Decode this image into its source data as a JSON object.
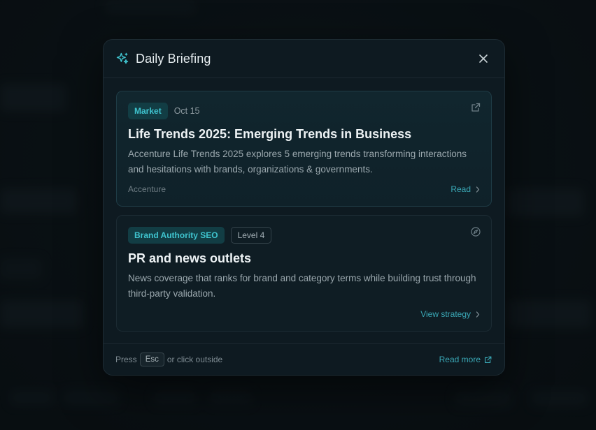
{
  "modal": {
    "title": "Daily Briefing",
    "close_icon": "close-icon",
    "header_icon": "sparkles-icon"
  },
  "cards": [
    {
      "tag": "Market",
      "date": "Oct 15",
      "title": "Life Trends 2025: Emerging Trends in Business",
      "description": "Accenture Life Trends 2025 explores 5 emerging trends transforming interactions and hesitations with brands, organizations & governments.",
      "source": "Accenture",
      "action_label": "Read",
      "corner_icon": "external-link-icon"
    },
    {
      "tag": "Brand Authority SEO",
      "level": "Level 4",
      "title": "PR and news outlets",
      "description": "News coverage that ranks for brand and category terms while building trust through third-party validation.",
      "action_label": "View strategy",
      "corner_icon": "compass-icon"
    }
  ],
  "footer": {
    "press_text": "Press",
    "key": "Esc",
    "after_key_text": "or click outside",
    "read_more_label": "Read more"
  },
  "colors": {
    "accent": "#3aa8b6",
    "tag_text": "#3fc4cf",
    "tag_bg": "#123d44",
    "modal_bg": "#0e1a21"
  }
}
